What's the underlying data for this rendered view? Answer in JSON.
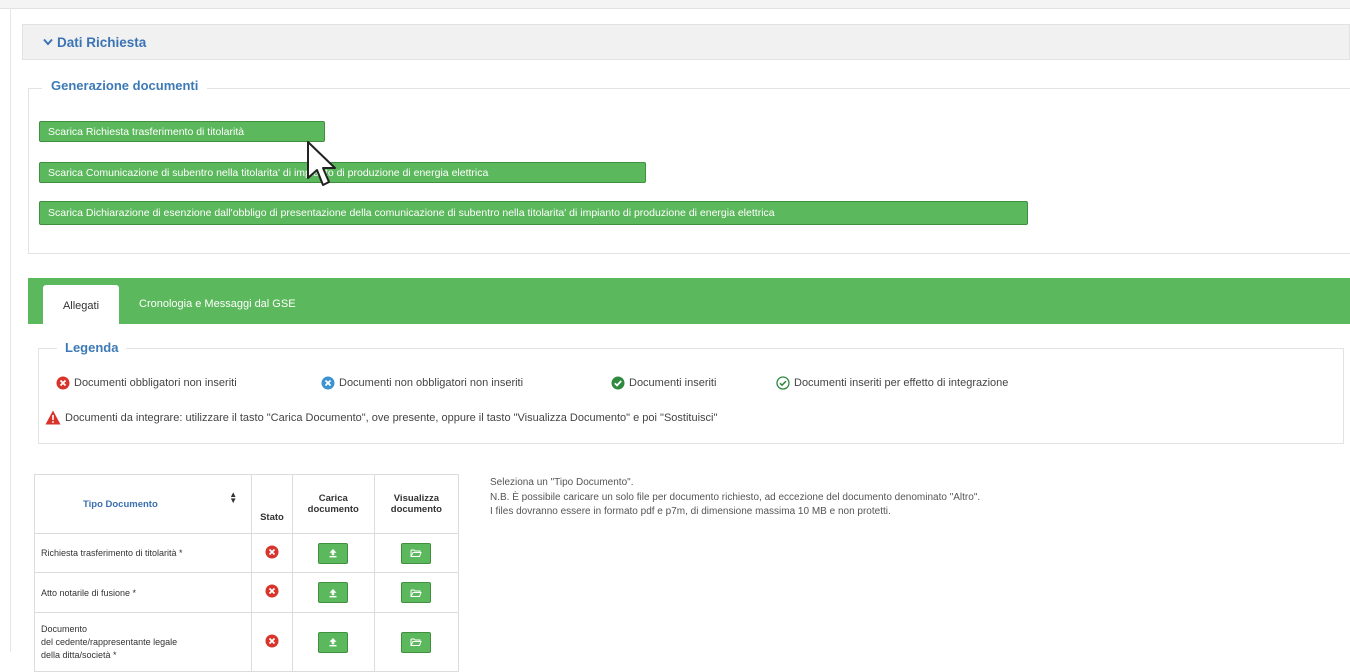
{
  "section": {
    "title": "Dati Richiesta",
    "chevron_icon": "chevron-down-icon"
  },
  "generazione": {
    "title": "Generazione documenti",
    "buttons": [
      "Scarica Richiesta trasferimento di titolarità",
      "Scarica Comunicazione di subentro nella titolarita' di impianto di produzione di energia elettrica",
      "Scarica Dichiarazione di esenzione dall'obbligo di presentazione della comunicazione di subentro nella titolarita' di impianto di produzione di energia elettrica"
    ]
  },
  "tabs": [
    "Allegati",
    "Cronologia e Messaggi dal GSE"
  ],
  "legenda": {
    "title": "Legenda",
    "items": [
      "Documenti obbligatori non inseriti",
      "Documenti non obbligatori non inseriti",
      "Documenti inseriti",
      "Documenti inseriti per effetto di integrazione"
    ],
    "warning": "Documenti da integrare: utilizzare il tasto \"Carica Documento\", ove presente, oppure il tasto \"Visualizza Documento\" e poi \"Sostituisci\""
  },
  "table": {
    "headers": {
      "tipo": "Tipo Documento",
      "stato": "Stato",
      "carica_1": "Carica",
      "carica_2": "documento",
      "visualizza_1": "Visualizza",
      "visualizza_2": "documento"
    },
    "rows": [
      {
        "name": "Richiesta trasferimento di titolarità *"
      },
      {
        "name": "Atto notarile di fusione *"
      },
      {
        "name_1": "Documento",
        "name_2": "del cedente/rappresentante legale",
        "name_3": "della ditta/società *"
      }
    ]
  },
  "info": {
    "line1": "Seleziona un \"Tipo Documento\".",
    "line2": "N.B. È possibile caricare un solo file per documento richiesto, ad eccezione del documento denominato \"Altro\".",
    "line3": "I files dovranno essere in formato pdf e p7m, di dimensione massima 10 MB e non protetti."
  },
  "colors": {
    "accent_green": "#5cb85c",
    "link_blue": "#3a74b5",
    "status_red": "#d9342b",
    "status_blue": "#3b93d2"
  }
}
